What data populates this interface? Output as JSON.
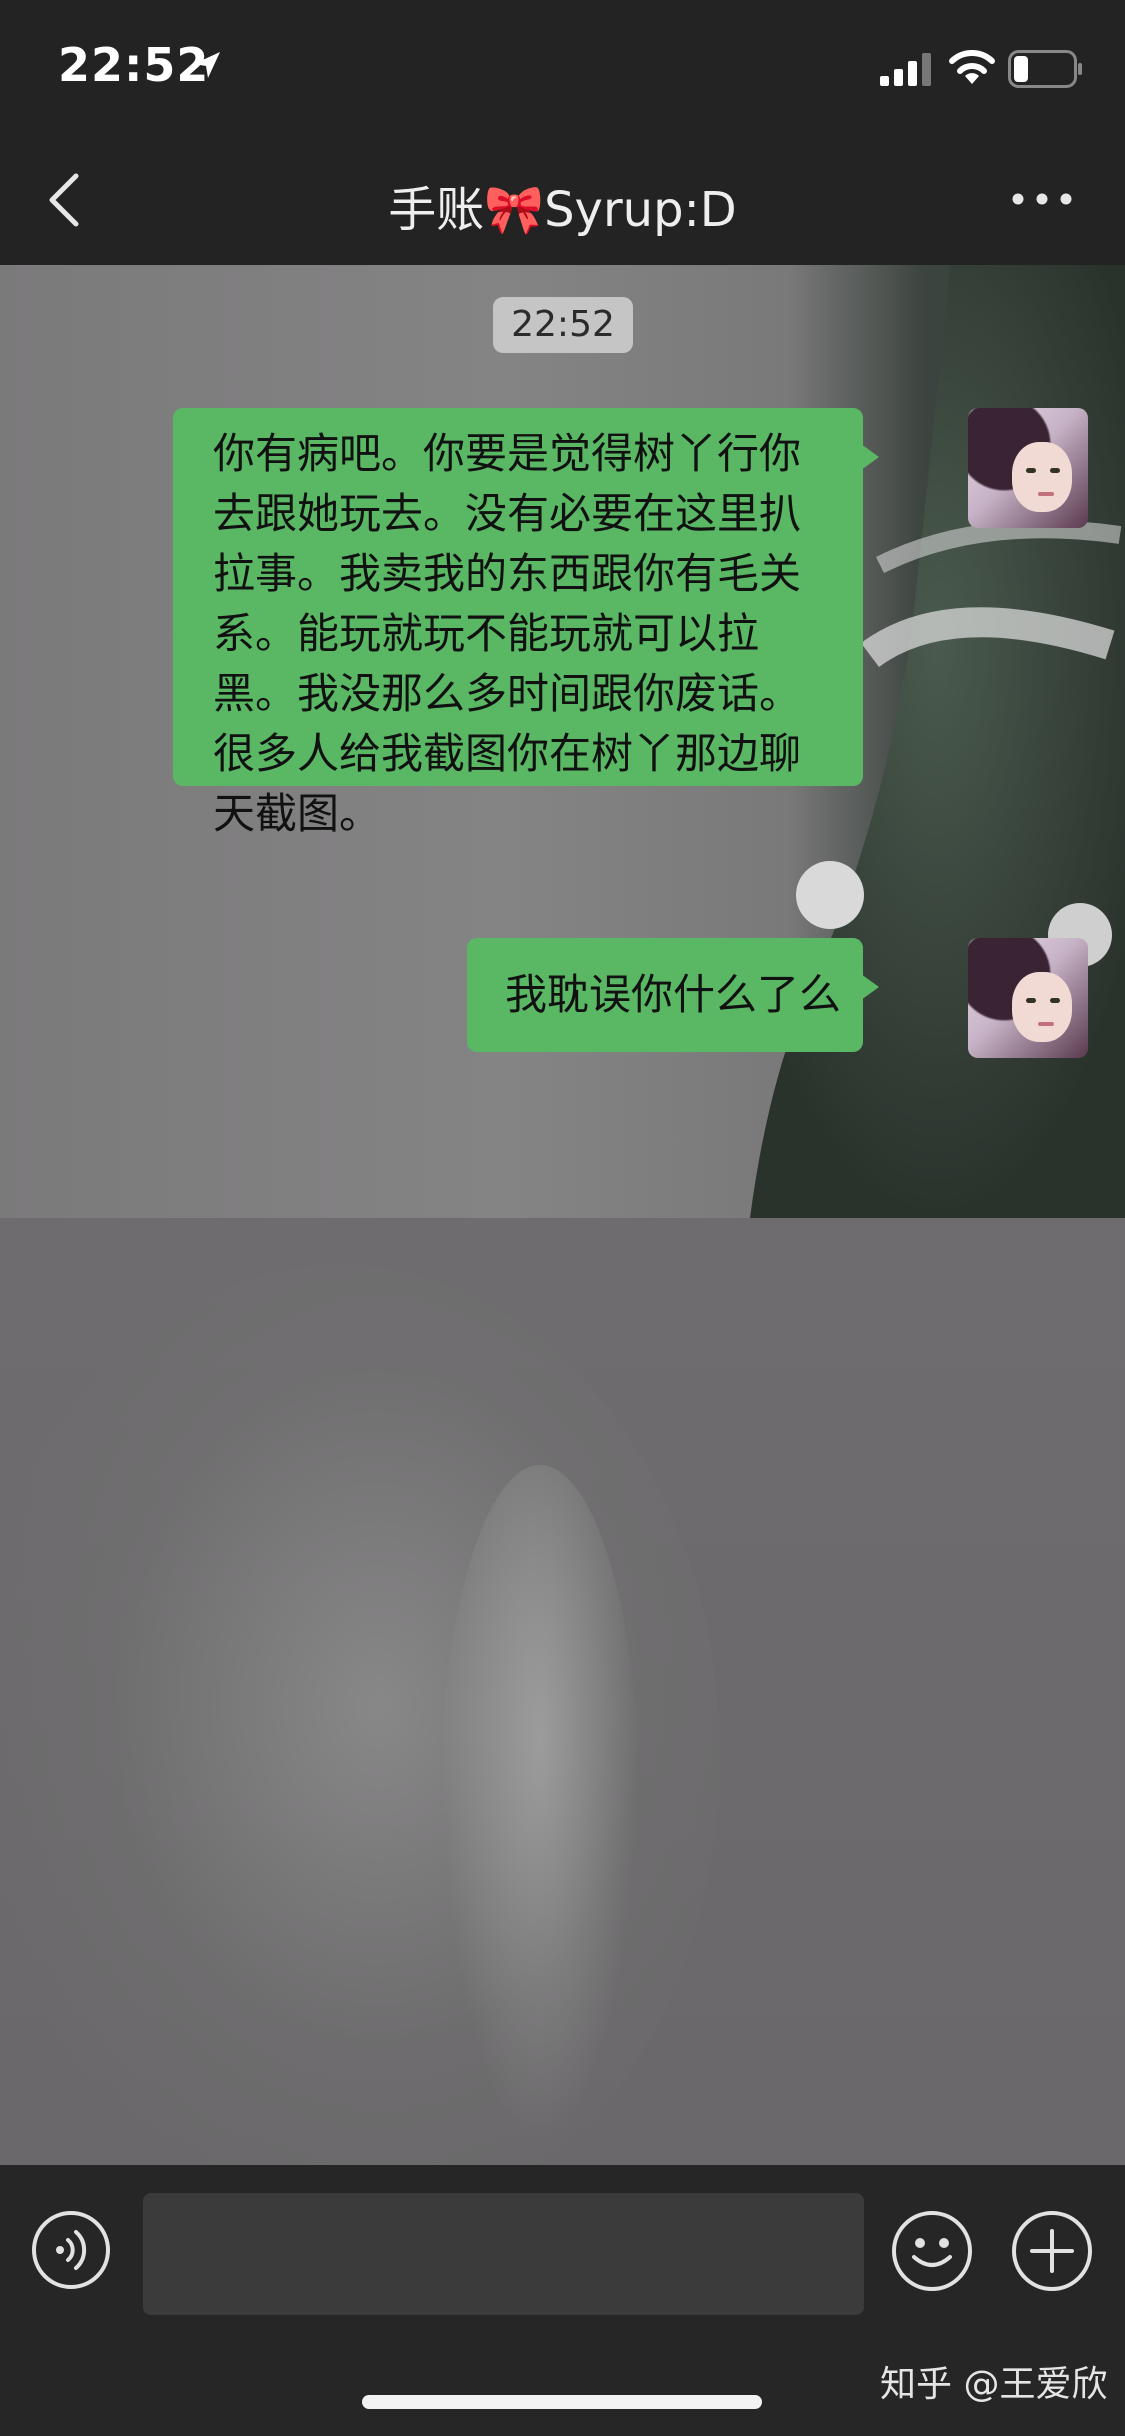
{
  "status_bar": {
    "time": "22:52",
    "icons": [
      "location-arrow-icon",
      "cellular-signal-icon",
      "wifi-icon",
      "battery-icon"
    ]
  },
  "nav": {
    "title": "手账🎀Syrup:D",
    "back_icon": "chevron-left-icon",
    "more_icon": "more-dots-icon"
  },
  "chat": {
    "timestamp": "22:52",
    "messages": [
      {
        "sender": "me",
        "lines": [
          "你有病吧。你要是觉得树丫行你",
          "去跟她玩去。没有必要在这里扒",
          "拉事。我卖我的东西跟你有毛关",
          "系。能玩就玩不能玩就可以拉",
          "黑。我没那么多时间跟你废话。",
          "很多人给我截图你在树丫那边聊",
          "天截图。"
        ]
      },
      {
        "sender": "me",
        "lines": [
          "我耽误你什么了么"
        ]
      }
    ]
  },
  "input_bar": {
    "voice_icon": "voice-input-icon",
    "emoji_icon": "emoji-icon",
    "plus_icon": "plus-icon",
    "placeholder": ""
  },
  "watermark": "知乎 @王爱欣"
}
